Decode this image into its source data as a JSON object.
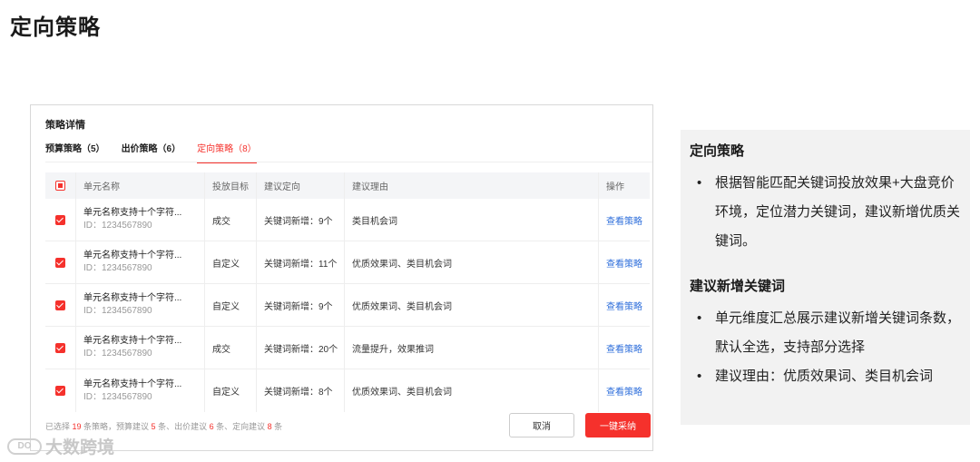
{
  "page": {
    "title": "定向策略"
  },
  "panel": {
    "title": "策略详情",
    "tabs": [
      {
        "label": "预算策略（5）",
        "active": false
      },
      {
        "label": "出价策略（6）",
        "active": false
      },
      {
        "label": "定向策略（8）",
        "active": true
      }
    ],
    "table": {
      "headers": [
        "单元名称",
        "投放目标",
        "建议定向",
        "建议理由",
        "操作"
      ],
      "rows": [
        {
          "name": "单元名称支持十个字符...",
          "id": "ID：1234567890",
          "goal": "成交",
          "direction": "关键词新增：9个",
          "reason": "类目机会词",
          "action": "查看策略"
        },
        {
          "name": "单元名称支持十个字符...",
          "id": "ID：1234567890",
          "goal": "自定义",
          "direction": "关键词新增：11个",
          "reason": "优质效果词、类目机会词",
          "action": "查看策略"
        },
        {
          "name": "单元名称支持十个字符...",
          "id": "ID：1234567890",
          "goal": "自定义",
          "direction": "关键词新增：9个",
          "reason": "优质效果词、类目机会词",
          "action": "查看策略"
        },
        {
          "name": "单元名称支持十个字符...",
          "id": "ID：1234567890",
          "goal": "成交",
          "direction": "关键词新增：20个",
          "reason": "流量提升，效果推词",
          "action": "查看策略"
        },
        {
          "name": "单元名称支持十个字符...",
          "id": "ID：1234567890",
          "goal": "自定义",
          "direction": "关键词新增：8个",
          "reason": "优质效果词、类目机会词",
          "action": "查看策略"
        }
      ]
    },
    "footer": {
      "p1": "已选择 ",
      "n1": "19",
      "p2": " 条策略，预算建议 ",
      "n2": "5",
      "p3": " 条、出价建议 ",
      "n3": "6",
      "p4": " 条、定向建议 ",
      "n4": "8",
      "p5": " 条",
      "cancel_label": "取消",
      "accept_label": "一键采纳"
    }
  },
  "watermark": {
    "logo_text": "DO",
    "text": "大数跨境"
  },
  "notes": {
    "heading1": "定向策略",
    "item1": "根据智能匹配关键词投放效果+大盘竞价环境，定位潜力关键词，建议新增优质关键词。",
    "heading2": "建议新增关键词",
    "item2": "单元维度汇总展示建议新增关键词条数，默认全选，支持部分选择",
    "item3": "建议理由：优质效果词、类目机会词"
  },
  "colors": {
    "accent": "#f5312c",
    "link": "#2f6fdb",
    "note_bg": "#f2f2f2"
  }
}
